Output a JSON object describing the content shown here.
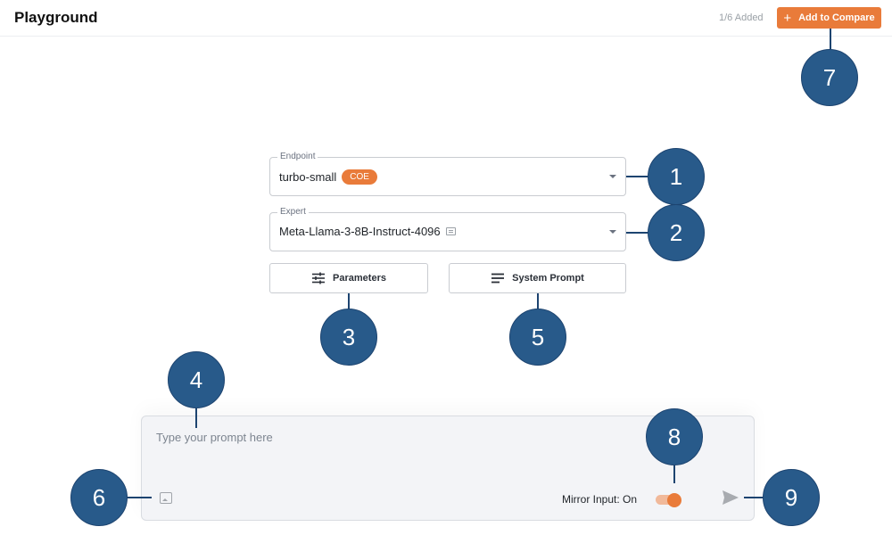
{
  "header": {
    "title": "Playground",
    "added_count": "1/6 Added",
    "compare_button": {
      "icon": "plus-icon",
      "label": "Add to Compare"
    }
  },
  "endpoint": {
    "label": "Endpoint",
    "value": "turbo-small",
    "badge": "COE",
    "icon": "chevron-down-icon"
  },
  "expert": {
    "label": "Expert",
    "value": "Meta-Llama-3-8B-Instruct-4096",
    "value_icon": "chat-icon",
    "icon": "chevron-down-icon"
  },
  "buttons": {
    "parameters": {
      "icon": "sliders-icon",
      "label": "Parameters"
    },
    "system_prompt": {
      "icon": "lines-icon",
      "label": "System Prompt"
    }
  },
  "prompt": {
    "placeholder": "Type your prompt here",
    "value": "",
    "attach_icon": "image-icon",
    "mirror_label": "Mirror Input: On",
    "mirror_on": true,
    "send_icon": "send-icon"
  },
  "colors": {
    "accent": "#e97b3a",
    "callout": "#285a8a"
  },
  "callouts": [
    "1",
    "2",
    "3",
    "4",
    "5",
    "6",
    "7",
    "8",
    "9"
  ]
}
